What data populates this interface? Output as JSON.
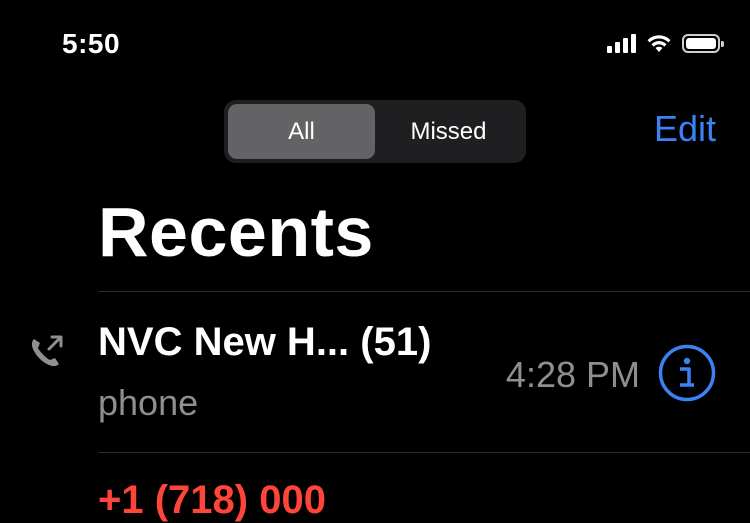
{
  "status_bar": {
    "time": "5:50",
    "icons": [
      "cellular-signal-icon",
      "wifi-icon",
      "battery-icon"
    ]
  },
  "segmented_control": {
    "options": [
      "All",
      "Missed"
    ],
    "selected": "All"
  },
  "header": {
    "edit_label": "Edit",
    "title": "Recents"
  },
  "calls": [
    {
      "name": "NVC New H... (51)",
      "type": "phone",
      "time": "4:28 PM",
      "icon": "outgoing-call-icon"
    }
  ],
  "next_row_partial_text": "+1 (718) 000",
  "colors": {
    "background": "#000000",
    "accent": "#3b82f6",
    "secondary_text": "#8e8e93",
    "missed": "#ff453a"
  }
}
